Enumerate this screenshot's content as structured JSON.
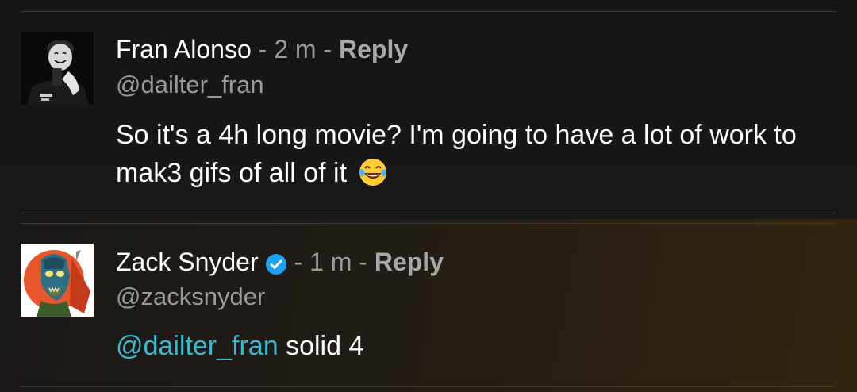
{
  "comments": [
    {
      "author": "Fran Alonso",
      "sep1": " - ",
      "time": "2 m",
      "sep2": " - ",
      "reply_label": "Reply",
      "handle": "@dailter_fran",
      "text": "So it's a 4h long movie? I'm going to have a lot of work to mak3 gifs of all of it",
      "emoji": "face-with-tears-of-joy-icon",
      "avatar": "avatar-icon"
    },
    {
      "author": "Zack Snyder",
      "verified": true,
      "sep1": " - ",
      "time": "1 m",
      "sep2": " - ",
      "reply_label": "Reply",
      "handle": "@zacksnyder",
      "mention": "@dailter_fran",
      "text": " solid 4",
      "avatar": "avatar-icon"
    }
  ],
  "colors": {
    "mention": "#3ab8cf",
    "verified": "#1da1f2",
    "meta": "#9a9a9a"
  }
}
